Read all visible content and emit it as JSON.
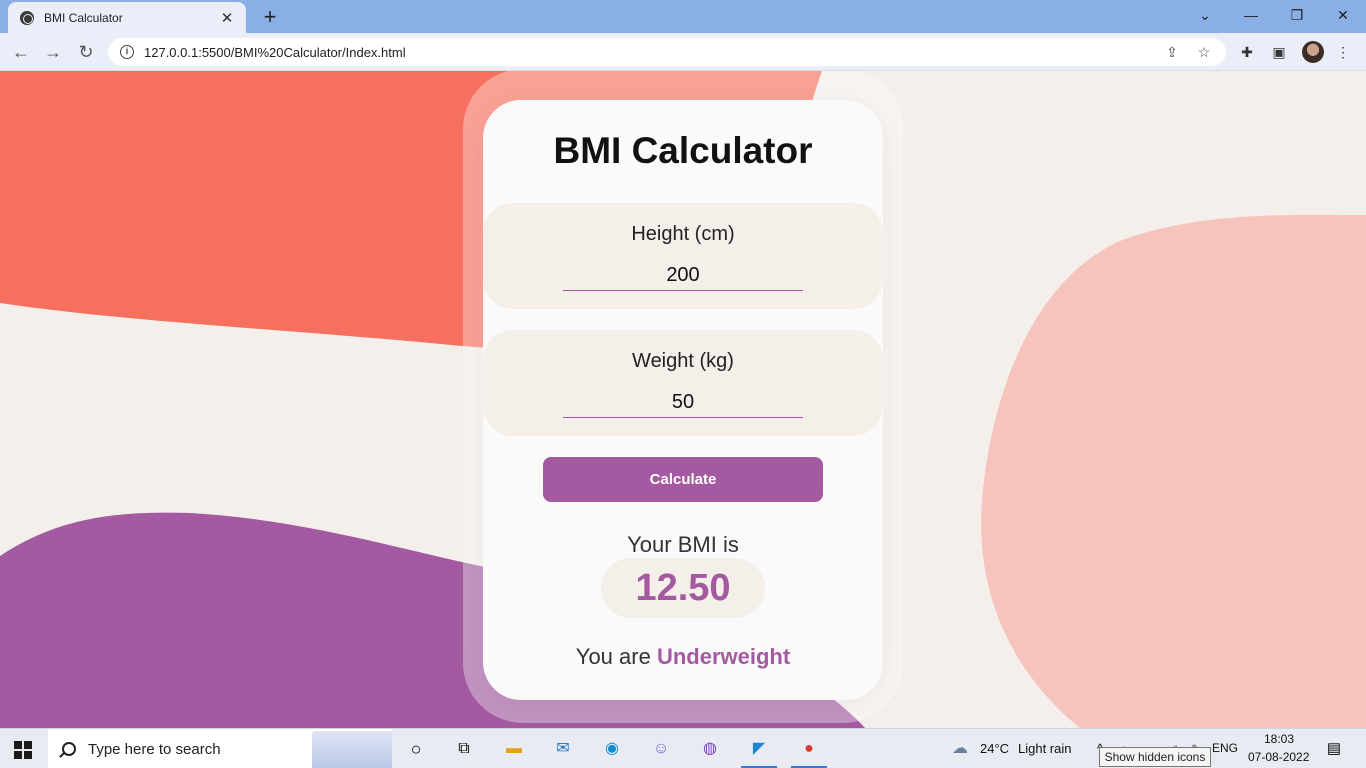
{
  "browser": {
    "tab_title": "BMI Calculator",
    "tab_close": "✕",
    "new_tab": "+",
    "url": "127.0.0.1:5500/BMI%20Calculator/Index.html"
  },
  "page": {
    "title": "BMI Calculator",
    "height_label": "Height (cm)",
    "height_value": "200",
    "weight_label": "Weight (kg)",
    "weight_value": "50",
    "calculate_label": "Calculate",
    "result_label": "Your BMI is",
    "bmi_value": "12.50",
    "status_prefix": "You are",
    "status_value": "Underweight"
  },
  "colors": {
    "accent": "#a35aa0",
    "coral": "#f76f5f",
    "pink": "#f6c4bc",
    "background": "#f4efea"
  },
  "taskbar": {
    "search_placeholder": "Type here to search",
    "weather_temp": "24°C",
    "weather_text": "Light rain",
    "language": "ENG",
    "time": "18:03",
    "date": "07-08-2022",
    "tooltip": "Show hidden icons"
  }
}
